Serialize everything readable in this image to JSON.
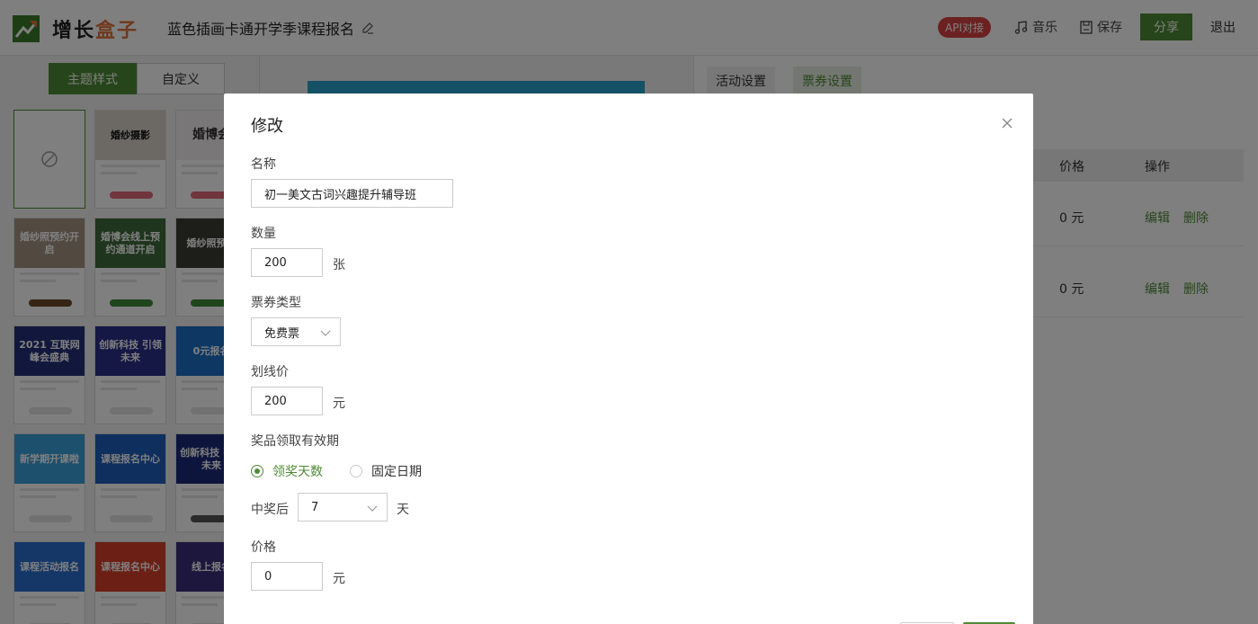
{
  "header": {
    "logo_text_a": "增长",
    "logo_text_b": "盒子",
    "project_title": "蓝色插画卡通开学季课程报名",
    "api_badge": "API对接",
    "music_label": "音乐",
    "save_label": "保存",
    "share_label": "分享",
    "exit_label": "退出"
  },
  "left_panel": {
    "tabs": [
      {
        "label": "主题样式"
      },
      {
        "label": "自定义"
      }
    ],
    "thumbnails": [
      {
        "title": ""
      },
      {
        "title": "婚纱摄影"
      },
      {
        "title": "婚博会"
      },
      {
        "title": "婚纱照预约开启"
      },
      {
        "title": "婚博会线上预约通道开启"
      },
      {
        "title": "婚纱照预约"
      },
      {
        "title": "2021 互联网峰会盛典"
      },
      {
        "title": "创新科技 引领未来"
      },
      {
        "title": "0元报名"
      },
      {
        "title": "新学期开课啦"
      },
      {
        "title": "课程报名中心"
      },
      {
        "title": "创新科技 引领未来"
      },
      {
        "title": "课程活动报名"
      },
      {
        "title": "课程报名中心"
      },
      {
        "title": "线上报名"
      }
    ]
  },
  "right_panel": {
    "tabs": [
      {
        "label": "活动设置"
      },
      {
        "label": "票券设置"
      }
    ],
    "table_headers": {
      "price": "价格",
      "action": "操作"
    },
    "rows": [
      {
        "price": "0 元",
        "edit": "编辑",
        "delete": "删除"
      },
      {
        "price": "0 元",
        "edit": "编辑",
        "delete": "删除"
      }
    ]
  },
  "modal": {
    "title": "修改",
    "name_label": "名称",
    "name_value": "初一美文古词兴趣提升辅导班",
    "qty_label": "数量",
    "qty_value": "200",
    "qty_unit": "张",
    "type_label": "票券类型",
    "type_value": "免费票",
    "strike_label": "划线价",
    "strike_value": "200",
    "strike_unit": "元",
    "validity_label": "奖品领取有效期",
    "radio_days": "领奖天数",
    "radio_fixed": "固定日期",
    "after_label": "中奖后",
    "days_value": "7",
    "days_unit": "天",
    "price_label": "价格",
    "price_value": "0",
    "price_unit": "元"
  },
  "colors": {
    "brand_green": "#4f8b35",
    "api_red": "#d94343",
    "preview_blue": "#2aa3c8"
  }
}
